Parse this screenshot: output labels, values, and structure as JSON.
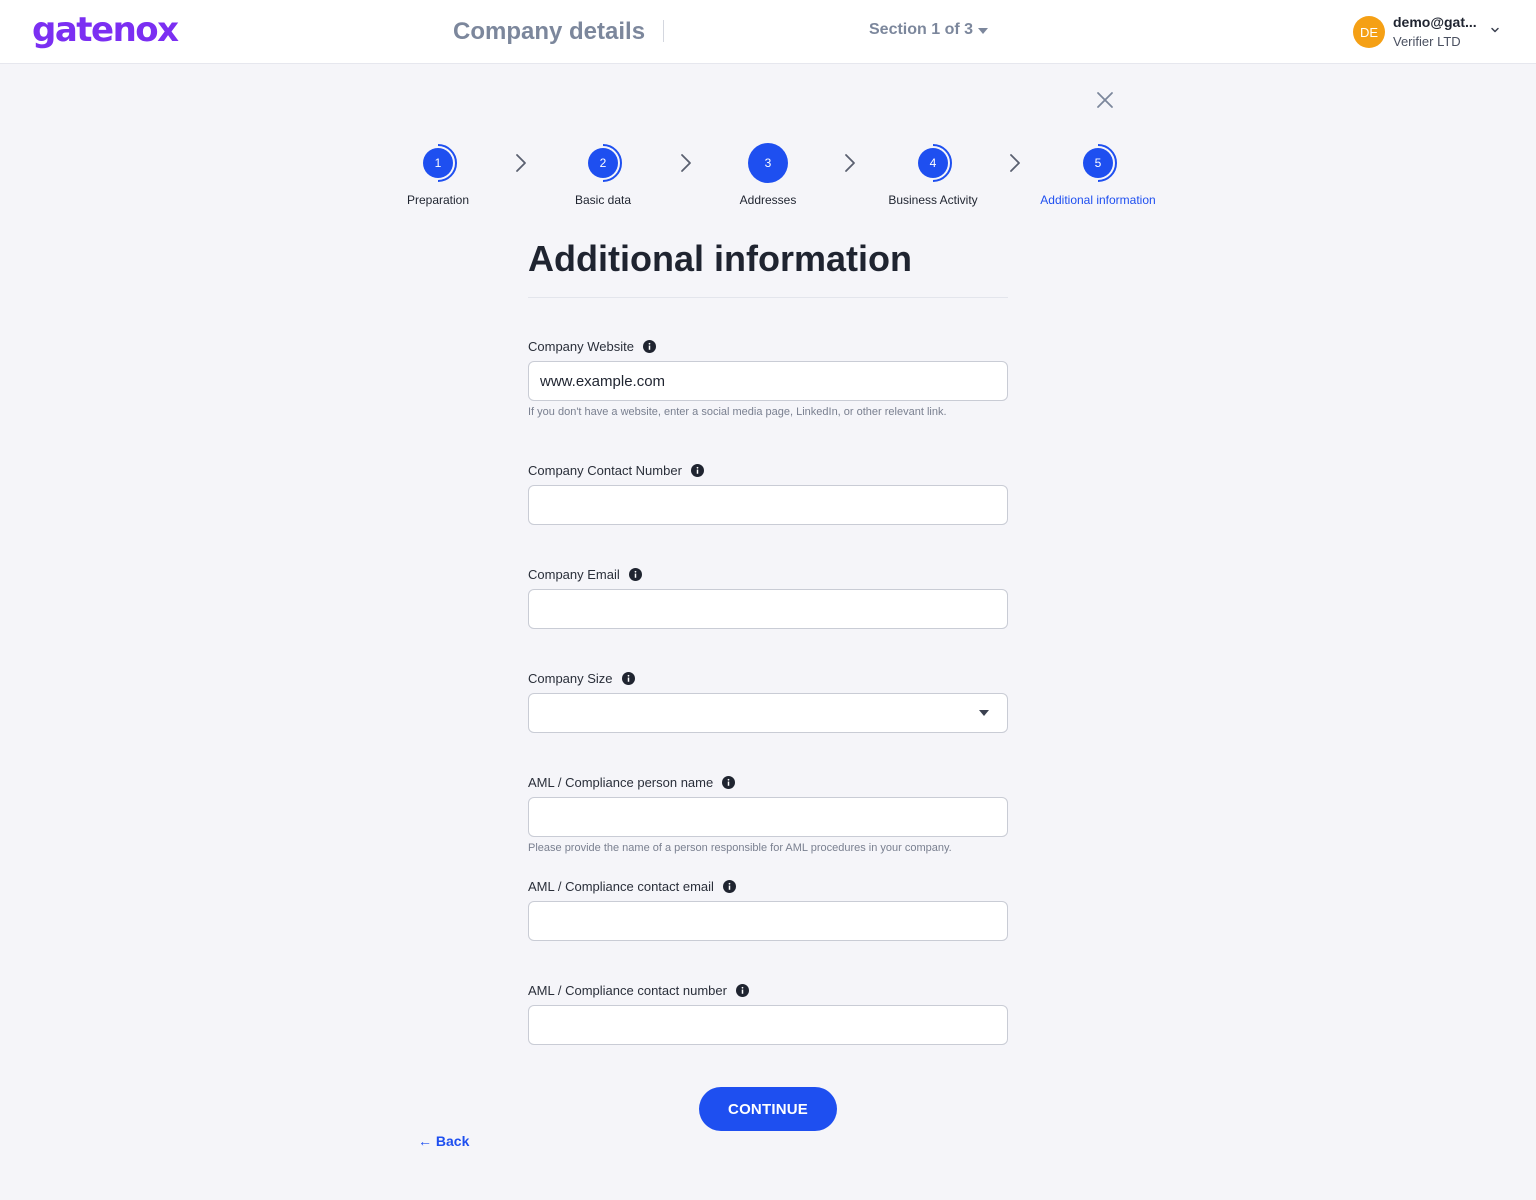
{
  "header": {
    "logo_text": "gatenox",
    "page_title": "Company details",
    "section_label": "Section 1 of 3",
    "user": {
      "initials": "DE",
      "email": "demo@gat...",
      "organization": "Verifier LTD",
      "avatar_color": "#f5a015"
    }
  },
  "stepper": {
    "steps": [
      {
        "number": "1",
        "label": "Preparation",
        "state": "complete"
      },
      {
        "number": "2",
        "label": "Basic data",
        "state": "complete"
      },
      {
        "number": "3",
        "label": "Addresses",
        "state": "complete"
      },
      {
        "number": "4",
        "label": "Business Activity",
        "state": "complete"
      },
      {
        "number": "5",
        "label": "Additional information",
        "state": "active"
      }
    ]
  },
  "form": {
    "title": "Additional information",
    "fields": [
      {
        "label": "Company Website",
        "value": "www.example.com",
        "placeholder": "",
        "helper": "If you don't have a website, enter a social media page, LinkedIn, or other relevant link."
      },
      {
        "label": "Company Contact Number",
        "value": "",
        "placeholder": ""
      },
      {
        "label": "Company Email",
        "value": "",
        "placeholder": ""
      },
      {
        "label": "Company Size",
        "value": "",
        "placeholder": ""
      },
      {
        "label": "AML / Compliance person name",
        "value": "",
        "placeholder": "",
        "helper": "Please provide the name of a person responsible for AML procedures in your company."
      },
      {
        "label": "AML / Compliance contact email",
        "value": "",
        "placeholder": ""
      },
      {
        "label": "AML / Compliance contact number",
        "value": "",
        "placeholder": ""
      }
    ]
  },
  "actions": {
    "continue_label": "CONTINUE",
    "back_label": "← Back"
  },
  "colors": {
    "brand": "#7b2ff2",
    "primary": "#1e4ff0",
    "muted_text": "#7c879c"
  },
  "icons": {
    "close": "close-icon",
    "info": "info-icon",
    "step_separator": "chevron-right-icon",
    "user_menu": "chevron-down-icon",
    "dropdown": "caret-down-icon"
  }
}
